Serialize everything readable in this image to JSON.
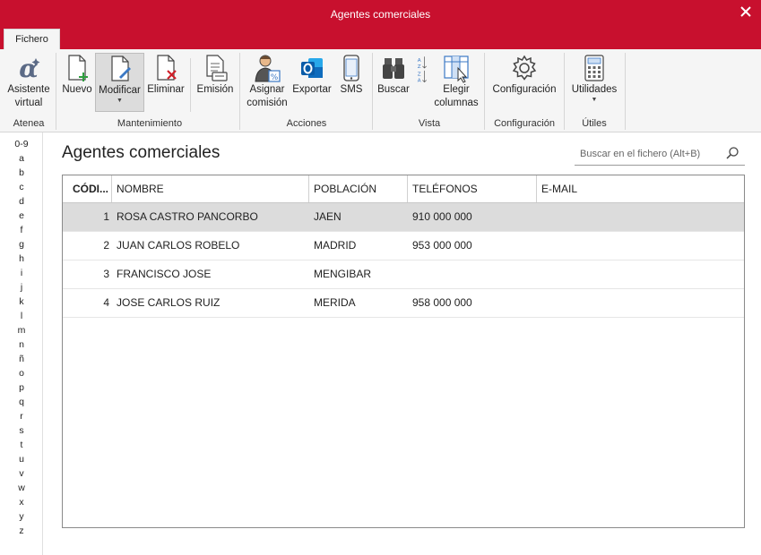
{
  "window": {
    "title": "Agentes comerciales"
  },
  "tabs": {
    "fichero": "Fichero"
  },
  "ribbon": {
    "atenea": {
      "asistente": [
        "Asistente",
        "virtual"
      ],
      "group": "Atenea"
    },
    "mantenimiento": {
      "nuevo": "Nuevo",
      "modificar": "Modificar",
      "eliminar": "Eliminar",
      "emision": "Emisión",
      "group": "Mantenimiento"
    },
    "acciones": {
      "asignar": [
        "Asignar",
        "comisión"
      ],
      "exportar": "Exportar",
      "sms": "SMS",
      "group": "Acciones"
    },
    "vista": {
      "buscar": "Buscar",
      "elegir": [
        "Elegir",
        "columnas"
      ],
      "group": "Vista"
    },
    "configuracion": {
      "configuracion": "Configuración",
      "group": "Configuración"
    },
    "utiles": {
      "utilidades": "Utilidades",
      "group": "Útiles"
    }
  },
  "alphabet": [
    "0-9",
    "a",
    "b",
    "c",
    "d",
    "e",
    "f",
    "g",
    "h",
    "i",
    "j",
    "k",
    "l",
    "m",
    "n",
    "ñ",
    "o",
    "p",
    "q",
    "r",
    "s",
    "t",
    "u",
    "v",
    "w",
    "x",
    "y",
    "z"
  ],
  "main": {
    "title": "Agentes comerciales"
  },
  "search": {
    "placeholder": "Buscar en el fichero (Alt+B)"
  },
  "table": {
    "columns": [
      "CÓDI...",
      "NOMBRE",
      "POBLACIÓN",
      "TELÉFONOS",
      "E-MAIL"
    ],
    "rows": [
      {
        "codigo": "1",
        "nombre": "ROSA CASTRO PANCORBO",
        "poblacion": "JAEN",
        "telefonos": "910 000 000",
        "email": "",
        "selected": true
      },
      {
        "codigo": "2",
        "nombre": "JUAN CARLOS ROBELO",
        "poblacion": "MADRID",
        "telefonos": "953 000 000",
        "email": ""
      },
      {
        "codigo": "3",
        "nombre": "FRANCISCO JOSE",
        "poblacion": "MENGIBAR",
        "telefonos": "",
        "email": ""
      },
      {
        "codigo": "4",
        "nombre": "JOSE CARLOS RUIZ",
        "poblacion": "MERIDA",
        "telefonos": "958 000 000",
        "email": ""
      }
    ]
  },
  "colors": {
    "brand": "#c8102e",
    "ribbon": "#f5f5f5",
    "selected_row": "#dcdcdc"
  }
}
